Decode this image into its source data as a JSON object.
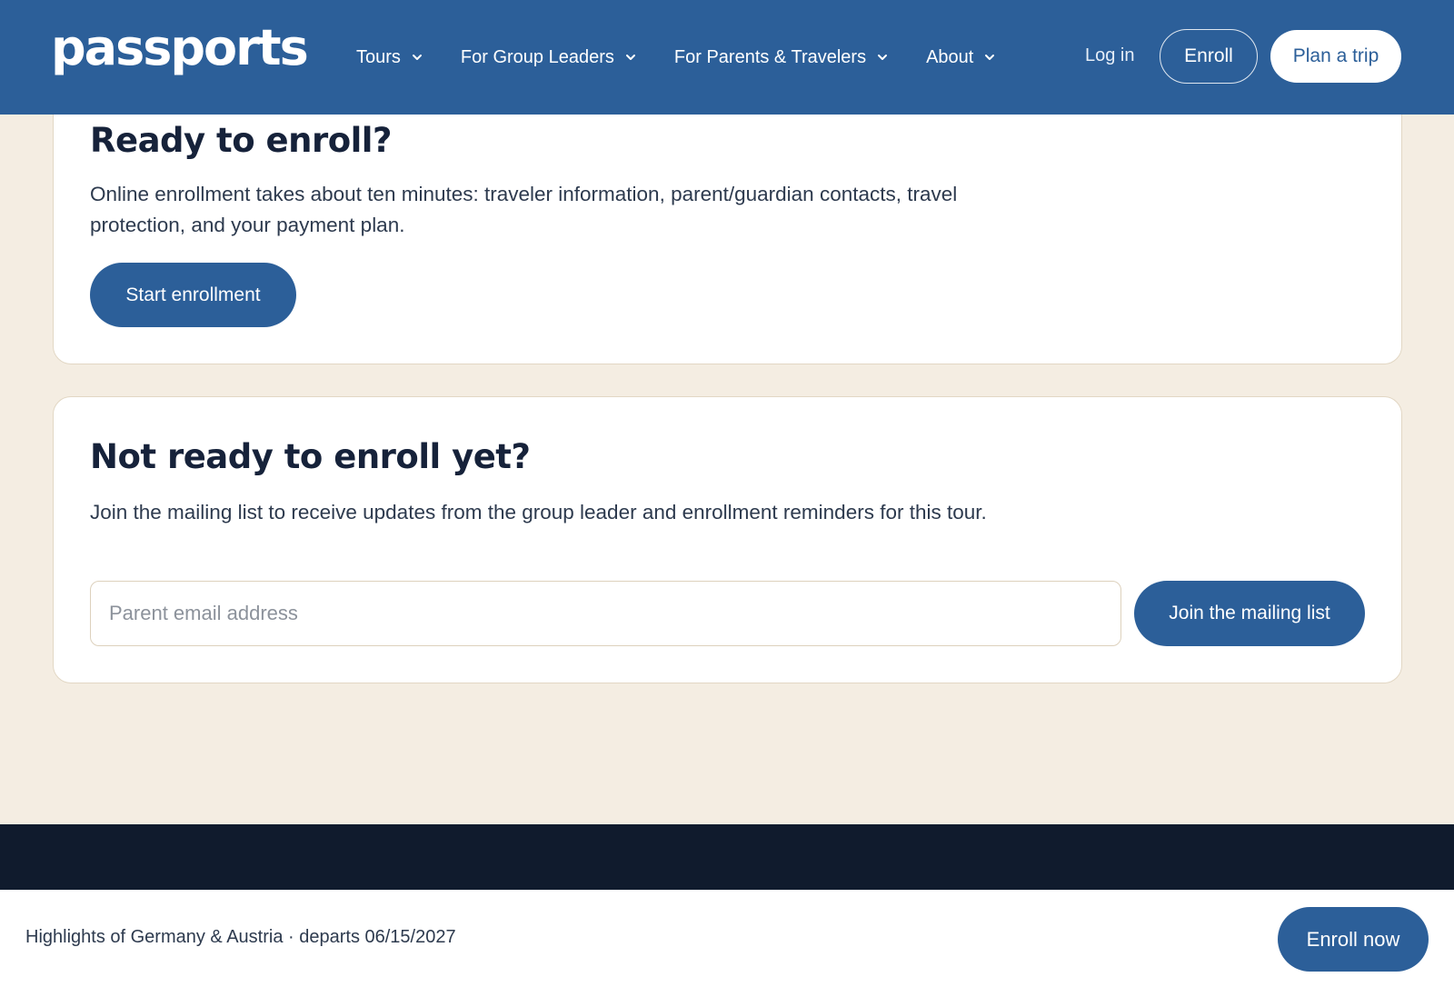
{
  "header": {
    "logo_text": "passports",
    "nav": [
      {
        "label": "Tours"
      },
      {
        "label": "For Group Leaders"
      },
      {
        "label": "For Parents & Travelers"
      },
      {
        "label": "About"
      }
    ],
    "login_label": "Log in",
    "enroll_label": "Enroll",
    "plan_trip_label": "Plan a trip"
  },
  "ready_card": {
    "title": "Ready to enroll?",
    "description": "Online enrollment takes about ten minutes: traveler information, parent/guardian contacts, travel protection, and your payment plan.",
    "button_label": "Start enrollment"
  },
  "not_ready_card": {
    "title": "Not ready to enroll yet?",
    "description": "Join the mailing list to receive updates from the group leader and enrollment reminders for this tour.",
    "email_placeholder": "Parent email address",
    "email_value": "",
    "button_label": "Join the mailing list"
  },
  "sticky_bar": {
    "tour_info": "Highlights of Germany & Austria · departs 06/15/2027",
    "button_label": "Enroll now"
  },
  "colors": {
    "brand_blue": "#2c5f99",
    "page_bg": "#f4ede2",
    "dark_band": "#101b2d"
  }
}
